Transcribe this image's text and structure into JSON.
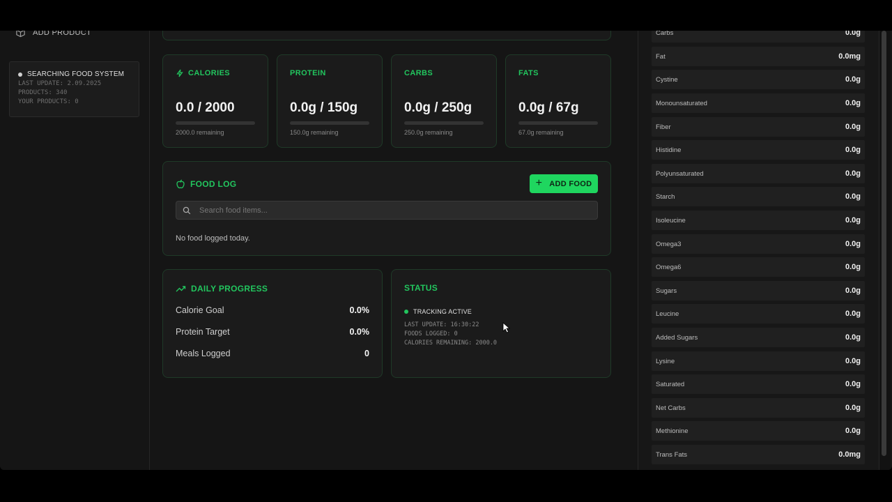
{
  "sidebar": {
    "add_product": "ADD PRODUCT",
    "system": {
      "title": "SEARCHING FOOD SYSTEM",
      "last_update": "LAST UPDATE: 2.09.2025",
      "products": "PRODUCTS: 340",
      "your_products": "YOUR PRODUCTS: 0"
    }
  },
  "stats": [
    {
      "label": "CALORIES",
      "value": "0.0 / 2000",
      "remaining": "2000.0 remaining",
      "progress": 0
    },
    {
      "label": "PROTEIN",
      "value": "0.0g / 150g",
      "remaining": "150.0g remaining",
      "progress": 0
    },
    {
      "label": "CARBS",
      "value": "0.0g / 250g",
      "remaining": "250.0g remaining",
      "progress": 0
    },
    {
      "label": "FATS",
      "value": "0.0g / 67g",
      "remaining": "67.0g remaining",
      "progress": 0
    }
  ],
  "food_log": {
    "title": "FOOD LOG",
    "add_button": "ADD FOOD",
    "search_placeholder": "Search food items...",
    "empty_message": "No food logged today."
  },
  "daily_progress": {
    "title": "DAILY PROGRESS",
    "rows": [
      {
        "label": "Calorie Goal",
        "value": "0.0%"
      },
      {
        "label": "Protein Target",
        "value": "0.0%"
      },
      {
        "label": "Meals Logged",
        "value": "0"
      }
    ]
  },
  "status": {
    "title": "STATUS",
    "tracking": "TRACKING ACTIVE",
    "last_update": "LAST UPDATE: 16:30:22",
    "foods_logged": "FOODS LOGGED: 0",
    "calories_remaining": "CALORIES REMAINING: 2000.0"
  },
  "nutrients": [
    {
      "name": "Carbs",
      "value": "0.0g"
    },
    {
      "name": "Fat",
      "value": "0.0mg"
    },
    {
      "name": "Cystine",
      "value": "0.0g"
    },
    {
      "name": "Monounsaturated",
      "value": "0.0g"
    },
    {
      "name": "Fiber",
      "value": "0.0g"
    },
    {
      "name": "Histidine",
      "value": "0.0g"
    },
    {
      "name": "Polyunsaturated",
      "value": "0.0g"
    },
    {
      "name": "Starch",
      "value": "0.0g"
    },
    {
      "name": "Isoleucine",
      "value": "0.0g"
    },
    {
      "name": "Omega3",
      "value": "0.0g"
    },
    {
      "name": "Omega6",
      "value": "0.0g"
    },
    {
      "name": "Sugars",
      "value": "0.0g"
    },
    {
      "name": "Leucine",
      "value": "0.0g"
    },
    {
      "name": "Added Sugars",
      "value": "0.0g"
    },
    {
      "name": "Lysine",
      "value": "0.0g"
    },
    {
      "name": "Saturated",
      "value": "0.0g"
    },
    {
      "name": "Net Carbs",
      "value": "0.0g"
    },
    {
      "name": "Methionine",
      "value": "0.0g"
    },
    {
      "name": "Trans Fats",
      "value": "0.0mg"
    }
  ],
  "colors": {
    "accent": "#22c55e",
    "button": "#1fd65f",
    "background": "#161616",
    "card": "#1b1b1b"
  }
}
